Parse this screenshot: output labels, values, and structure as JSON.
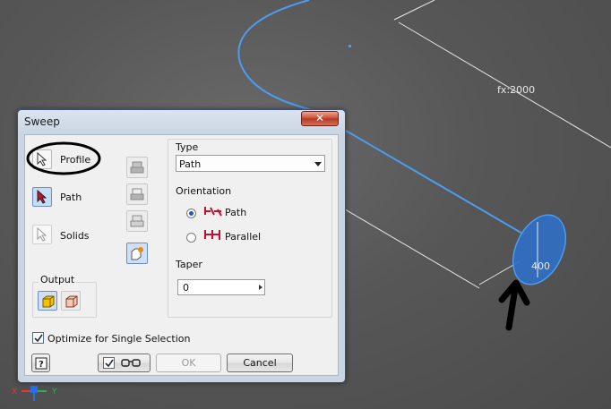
{
  "viewport": {
    "dimension_label": "fx:2000",
    "diameter_label": "400",
    "colors": {
      "background": "#575757",
      "sketch": "#4d9bef",
      "profile_fill": "#2f6fc6",
      "dimension": "#e8e8e8"
    }
  },
  "dialog": {
    "title": "Sweep",
    "close_label": "✕",
    "selectors": [
      {
        "label": "Profile",
        "icon": "cursor-icon",
        "active": false
      },
      {
        "label": "Path",
        "icon": "cursor-icon",
        "active": true
      },
      {
        "label": "Solids",
        "icon": "cursor-icon",
        "active": false
      }
    ],
    "output": {
      "label": "Output",
      "options": [
        "solid-output-icon",
        "surface-output-icon"
      ],
      "selected": 0
    },
    "middle_buttons": [
      "join-icon",
      "cut-icon",
      "intersect-icon",
      "new-solid-icon"
    ],
    "type": {
      "label": "Type",
      "value": "Path"
    },
    "orientation": {
      "label": "Orientation",
      "options": [
        {
          "label": "Path",
          "checked": true
        },
        {
          "label": "Parallel",
          "checked": false
        }
      ]
    },
    "taper": {
      "label": "Taper",
      "value": "0"
    },
    "optimize": {
      "label": "Optimize for Single Selection",
      "checked": true
    },
    "buttons": {
      "ok": "OK",
      "cancel": "Cancel",
      "help_icon": "help-icon",
      "preview_icon": "glasses-icon"
    },
    "accent": "#c7dcf5"
  }
}
